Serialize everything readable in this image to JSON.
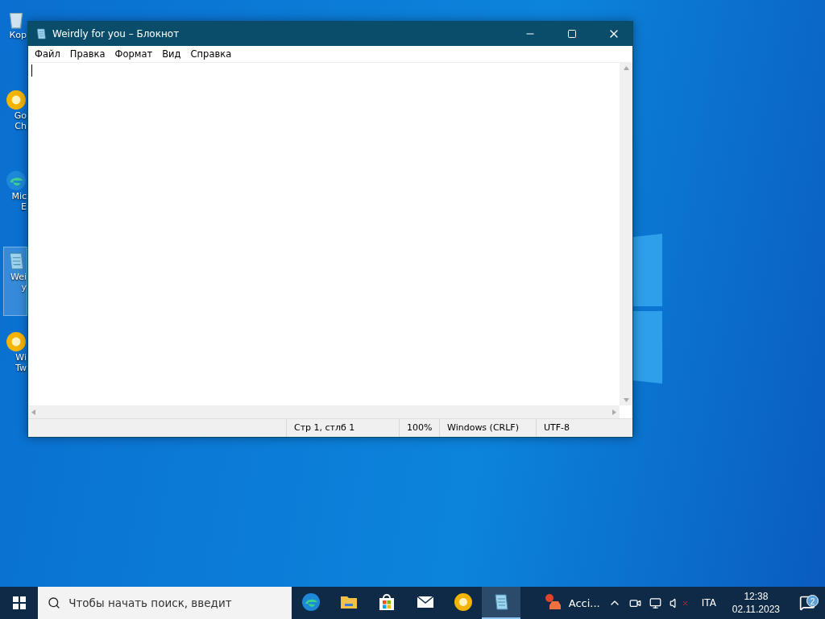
{
  "desktop": {
    "icons": [
      {
        "kind": "recycle",
        "lines": [
          "Кор"
        ],
        "selected": false
      },
      {
        "kind": "chrome",
        "lines": [
          "Go",
          "Ch"
        ],
        "selected": false
      },
      {
        "kind": "edge",
        "lines": [
          "Mic",
          "E"
        ],
        "selected": false
      },
      {
        "kind": "notepad",
        "lines": [
          "Wei",
          "y"
        ],
        "selected": true
      },
      {
        "kind": "chrome",
        "lines": [
          "Wi",
          "Tw"
        ],
        "selected": false
      }
    ]
  },
  "window": {
    "title": "Weirdly for you – Блокнот",
    "menu": [
      "Файл",
      "Правка",
      "Формат",
      "Вид",
      "Справка"
    ],
    "status_bar": [
      "Стр 1, стлб 1",
      "100%",
      "Windows (CRLF)",
      "UTF-8"
    ]
  },
  "taskbar": {
    "search": {
      "placeholder": "Чтобы начать поиск, введит"
    },
    "apps": [
      {
        "kind": "edge",
        "selected": false
      },
      {
        "kind": "folder",
        "selected": false
      },
      {
        "kind": "store",
        "selected": false
      },
      {
        "kind": "mail",
        "selected": false
      },
      {
        "kind": "chrome",
        "selected": false
      },
      {
        "kind": "notepad",
        "selected": true
      }
    ],
    "alert": {
      "label": "Acci..."
    },
    "language": "ITA",
    "time": "12:38",
    "date": "02.11.2023",
    "notifications": "2"
  }
}
